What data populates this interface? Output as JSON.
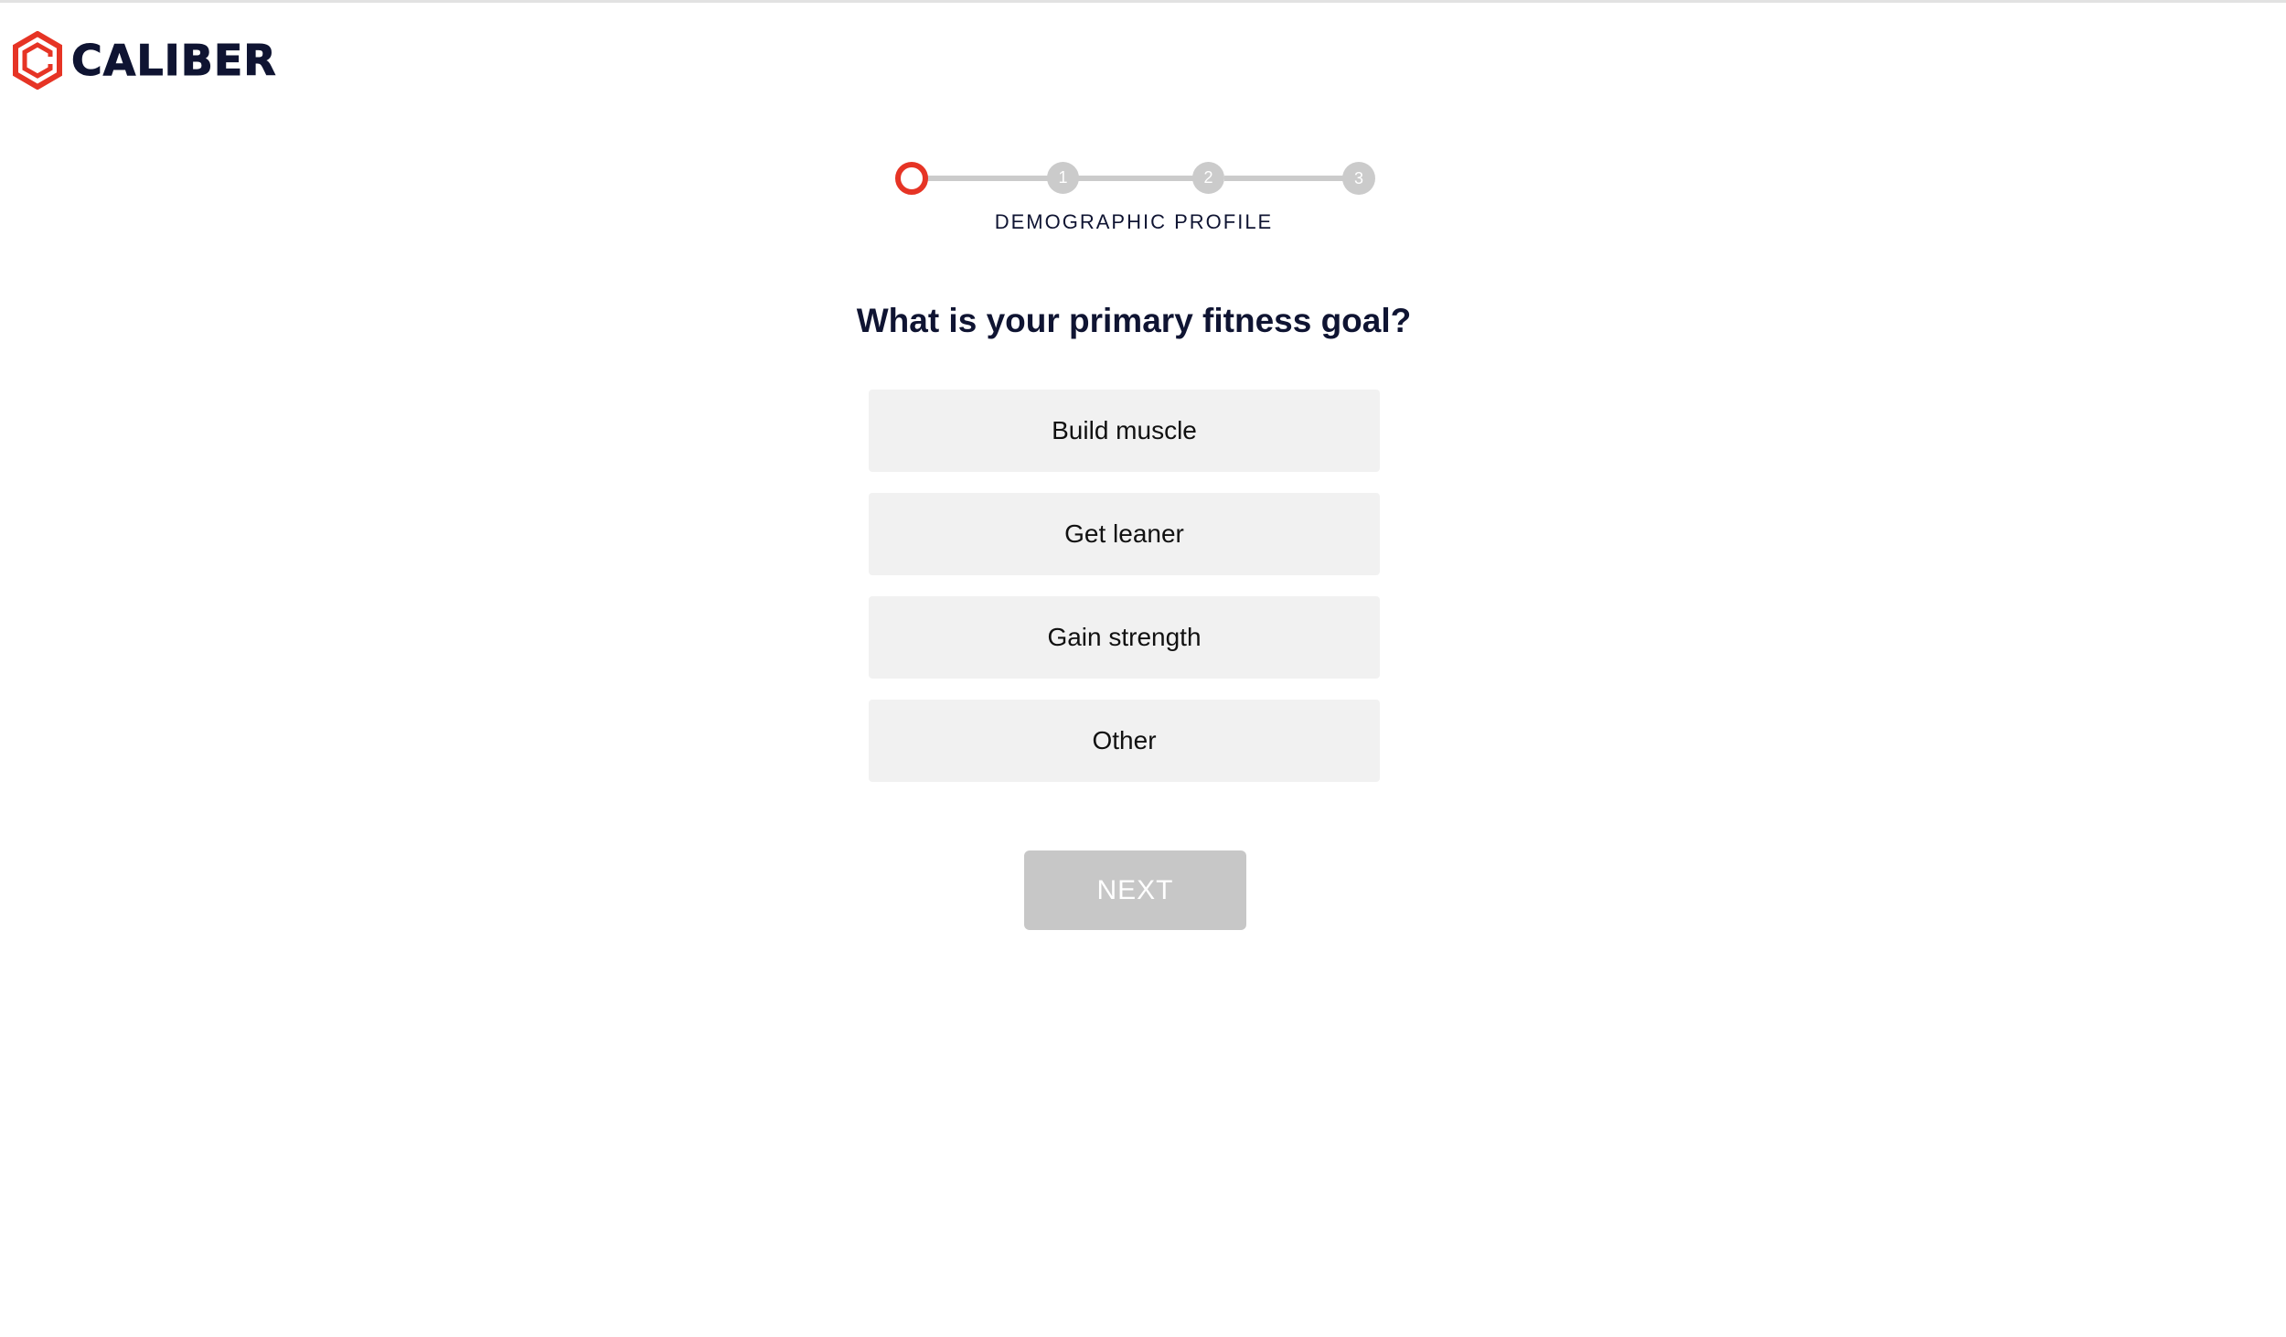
{
  "brand": {
    "name": "CALIBER",
    "logo_icon": "caliber-hexagon-logo",
    "accent_color": "#e63425",
    "text_color": "#0f1432"
  },
  "stepper": {
    "current_step_icon": "current-step-ring",
    "steps": [
      {
        "label": ""
      },
      {
        "label": "1"
      },
      {
        "label": "2"
      },
      {
        "label": "3"
      }
    ],
    "caption": "DEMOGRAPHIC PROFILE"
  },
  "question": {
    "title": "What is your primary fitness goal?",
    "options": [
      {
        "label": "Build muscle"
      },
      {
        "label": "Get leaner"
      },
      {
        "label": "Gain strength"
      },
      {
        "label": "Other"
      }
    ]
  },
  "actions": {
    "next_label": "NEXT",
    "next_state": "disabled"
  }
}
